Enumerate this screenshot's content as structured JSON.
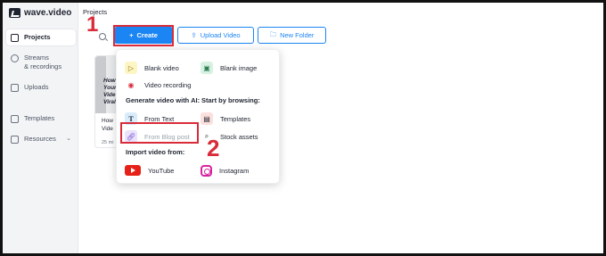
{
  "app": {
    "name": "wave.video"
  },
  "sidebar": {
    "items": [
      {
        "label": "Projects",
        "icon": "folder-icon"
      },
      {
        "label": "Streams\n& recordings",
        "icon": "stream-icon"
      },
      {
        "label": "Uploads",
        "icon": "upload-icon"
      },
      {
        "label": "Templates",
        "icon": "templates-icon"
      },
      {
        "label": "Resources",
        "icon": "resources-icon"
      }
    ]
  },
  "header": {
    "title": "Projects",
    "create_label": "Create",
    "upload_label": "Upload Video",
    "folder_label": "New Folder"
  },
  "card": {
    "thumb_text": "How\nYour\nVide\nViral",
    "title": "How\nVide",
    "meta": "25 mi"
  },
  "menu": {
    "blank_video": "Blank video",
    "blank_image": "Blank image",
    "video_recording": "Video recording",
    "ai_header": "Generate video with AI:",
    "browse_header": "Start by browsing:",
    "from_text": "From Text",
    "templates": "Templates",
    "from_blog": "From Blog post",
    "stock_assets": "Stock assets",
    "import_header": "Import video from:",
    "youtube": "YouTube",
    "instagram": "Instagram"
  },
  "annotations": {
    "step1": "1",
    "step2": "2"
  },
  "colors": {
    "accent": "#1b85f3",
    "annotation": "#d92b3a"
  }
}
